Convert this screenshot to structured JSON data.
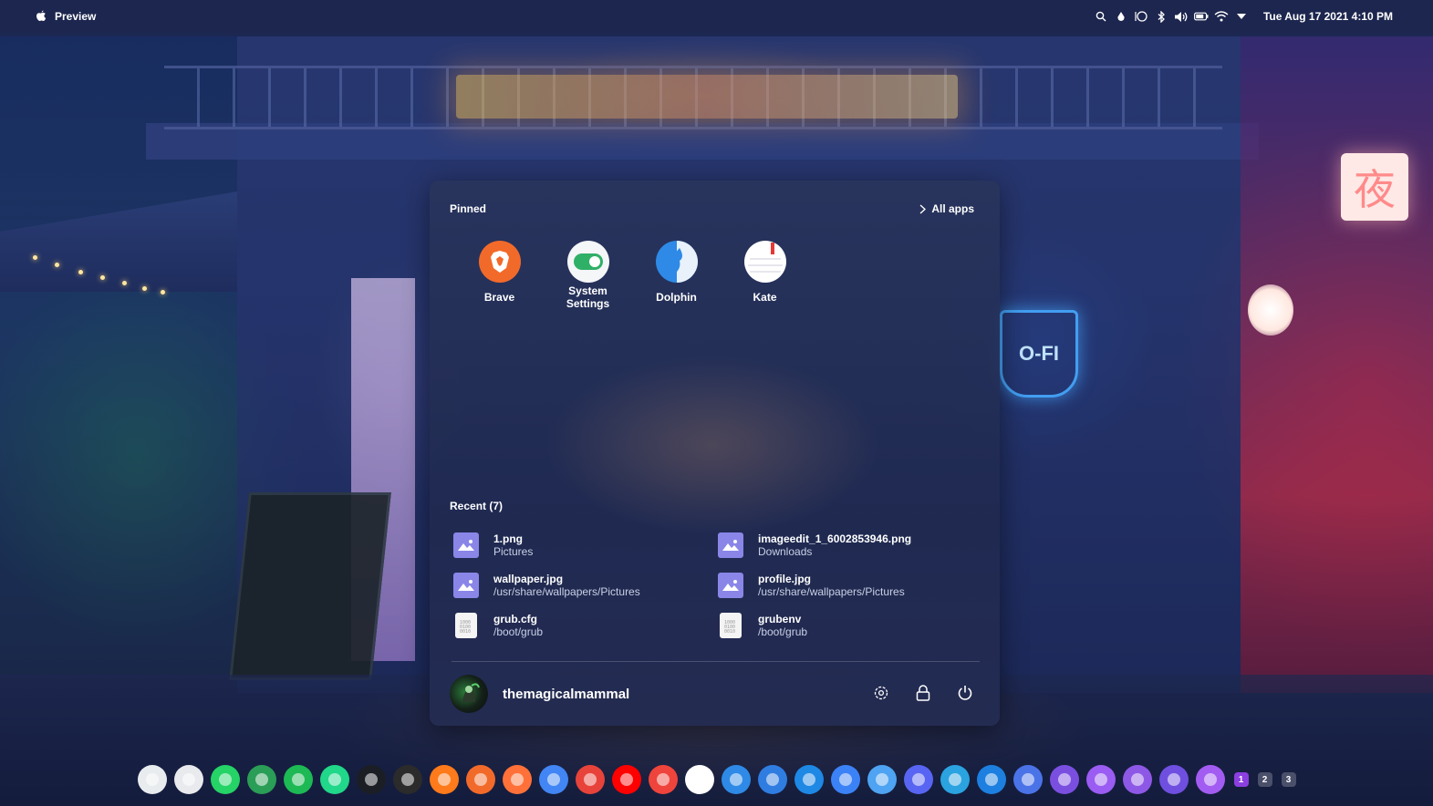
{
  "topbar": {
    "app_title": "Preview",
    "clock": "Tue Aug 17 2021 4:10 PM",
    "tray_icons": [
      "search-icon",
      "drop-icon",
      "circle-icon",
      "bluetooth-icon",
      "volume-icon",
      "battery-icon",
      "wifi-icon",
      "chevron-down-icon"
    ]
  },
  "wallpaper": {
    "kanji": "夜",
    "coffee_neon": "O-FI"
  },
  "launcher": {
    "pinned_title": "Pinned",
    "all_apps_label": "All apps",
    "pinned": [
      {
        "label": "Brave",
        "icon": "brave-icon",
        "color": "#f26a2a"
      },
      {
        "label": "System\nSettings",
        "icon": "toggle-icon",
        "color": "#2fb067"
      },
      {
        "label": "Dolphin",
        "icon": "dolphin-icon",
        "color": "#2e8ae6"
      },
      {
        "label": "Kate",
        "icon": "kate-icon",
        "color": "#ffffff"
      }
    ],
    "recent_title": "Recent (7)",
    "recent": [
      {
        "name": "1.png",
        "path": "Pictures",
        "icon": "image-file-icon"
      },
      {
        "name": "imageedit_1_6002853946.png",
        "path": "Downloads",
        "icon": "image-file-icon"
      },
      {
        "name": "wallpaper.jpg",
        "path": "/usr/share/wallpapers/Pictures",
        "icon": "image-file-icon"
      },
      {
        "name": "profile.jpg",
        "path": "/usr/share/wallpapers/Pictures",
        "icon": "image-file-icon"
      },
      {
        "name": "grub.cfg",
        "path": "/boot/grub",
        "icon": "binary-file-icon"
      },
      {
        "name": "grubenv",
        "path": "/boot/grub",
        "icon": "binary-file-icon"
      }
    ],
    "user": {
      "name": "themagicalmammal"
    },
    "actions": [
      "settings-icon",
      "lock-icon",
      "power-icon"
    ]
  },
  "dock": {
    "apps": [
      {
        "name": "system-settings",
        "color": "#e9ecef"
      },
      {
        "name": "chromium",
        "color": "#e8eaed"
      },
      {
        "name": "whatsapp",
        "color": "#25d366"
      },
      {
        "name": "vim",
        "color": "#2a9d56"
      },
      {
        "name": "spotify",
        "color": "#1db954"
      },
      {
        "name": "pycharm",
        "color": "#21d789"
      },
      {
        "name": "terminal",
        "color": "#1b1e24"
      },
      {
        "name": "sublime-text",
        "color": "#2b2b2b"
      },
      {
        "name": "headphones",
        "color": "#ff7a1a"
      },
      {
        "name": "brave",
        "color": "#f26a2a"
      },
      {
        "name": "firefox",
        "color": "#ff7139"
      },
      {
        "name": "chrome",
        "color": "#4285f4"
      },
      {
        "name": "feather",
        "color": "#e8433a"
      },
      {
        "name": "youtube",
        "color": "#ff0000"
      },
      {
        "name": "anydesk",
        "color": "#ef443b"
      },
      {
        "name": "kate",
        "color": "#ffffff"
      },
      {
        "name": "dolphin",
        "color": "#2e8ae6"
      },
      {
        "name": "drop",
        "color": "#2f7de1"
      },
      {
        "name": "sync",
        "color": "#1e88e5"
      },
      {
        "name": "krita",
        "color": "#3b82f6"
      },
      {
        "name": "recycle",
        "color": "#4ea3f2"
      },
      {
        "name": "discord",
        "color": "#5865f2"
      },
      {
        "name": "telegram",
        "color": "#2aa3e0"
      },
      {
        "name": "calculator",
        "color": "#1d7fe0"
      },
      {
        "name": "video-player",
        "color": "#4a73e8"
      },
      {
        "name": "crop-tool",
        "color": "#7a4fe0"
      },
      {
        "name": "typora",
        "color": "#9a5cf2"
      },
      {
        "name": "github",
        "color": "#8e58e6"
      },
      {
        "name": "vscode",
        "color": "#6f4fe0"
      },
      {
        "name": "trash",
        "color": "#a35cf2"
      }
    ],
    "workspaces": [
      "1",
      "2",
      "3"
    ],
    "workspace_colors": [
      "#8b3fe0",
      "#4a4f6a",
      "#4a4f6a"
    ]
  }
}
